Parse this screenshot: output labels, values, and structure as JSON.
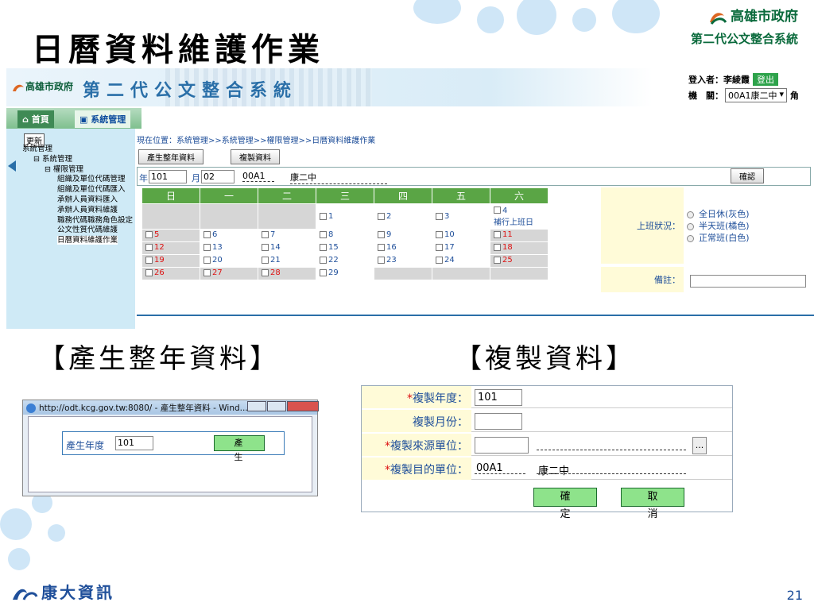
{
  "slide": {
    "title": "日曆資料維護作業",
    "gov_name": "高雄市政府",
    "gov_system": "第二代公文整合系統",
    "page_number": "21",
    "footer_company": "康大資訊"
  },
  "app": {
    "banner_logo": "高雄市政府",
    "system_title": "第二代公文整合系統",
    "login_label": "登入者：李綾霞",
    "logout_label": "登出",
    "org_label": "機　關：",
    "org_value": "00A1康二中",
    "org_trailing": "角",
    "tabs": {
      "home": "首頁",
      "system": "系統管理"
    },
    "sidebar": {
      "refresh": "更新",
      "items": [
        "系統管理",
        "系統管理",
        "權限管理",
        "組織及單位代碼管理",
        "組織及單位代碼匯入",
        "承辦人員資料匯入",
        "承辦人員資料維護",
        "職務代碼職務角色設定",
        "公文性質代碼維護",
        "日曆資料維護作業"
      ]
    },
    "breadcrumb": "現在位置：系統管理>>系統管理>>權限管理>>日曆資料維護作業",
    "buttons": {
      "generate": "產生整年資料",
      "copy": "複製資料",
      "confirm": "確認"
    },
    "filter": {
      "year_label": "年",
      "year": "101",
      "month_label": "月",
      "month": "02",
      "unit_code": "00A1",
      "unit_name": "康二中"
    },
    "calendar": {
      "weekdays": [
        "日",
        "一",
        "二",
        "三",
        "四",
        "五",
        "六"
      ],
      "extra_note": "補行上班日",
      "days": [
        {
          "d": "",
          "c": "g"
        },
        {
          "d": "",
          "c": "g"
        },
        {
          "d": "",
          "c": "g"
        },
        {
          "d": "1",
          "c": "w"
        },
        {
          "d": "2",
          "c": "w"
        },
        {
          "d": "3",
          "c": "w"
        },
        {
          "d": "4",
          "c": "w",
          "note": true
        },
        {
          "d": "5",
          "c": "g",
          "r": true
        },
        {
          "d": "6",
          "c": "w"
        },
        {
          "d": "7",
          "c": "w"
        },
        {
          "d": "8",
          "c": "w"
        },
        {
          "d": "9",
          "c": "w"
        },
        {
          "d": "10",
          "c": "w"
        },
        {
          "d": "11",
          "c": "g",
          "r": true
        },
        {
          "d": "12",
          "c": "g",
          "r": true
        },
        {
          "d": "13",
          "c": "w"
        },
        {
          "d": "14",
          "c": "w"
        },
        {
          "d": "15",
          "c": "w"
        },
        {
          "d": "16",
          "c": "w"
        },
        {
          "d": "17",
          "c": "w"
        },
        {
          "d": "18",
          "c": "g",
          "r": true
        },
        {
          "d": "19",
          "c": "g",
          "r": true
        },
        {
          "d": "20",
          "c": "w"
        },
        {
          "d": "21",
          "c": "w"
        },
        {
          "d": "22",
          "c": "w"
        },
        {
          "d": "23",
          "c": "w"
        },
        {
          "d": "24",
          "c": "w"
        },
        {
          "d": "25",
          "c": "g",
          "r": true
        },
        {
          "d": "26",
          "c": "g",
          "r": true
        },
        {
          "d": "27",
          "c": "g",
          "r": true
        },
        {
          "d": "28",
          "c": "g",
          "r": true
        },
        {
          "d": "29",
          "c": "w"
        },
        {
          "d": "",
          "c": "g"
        },
        {
          "d": "",
          "c": "g"
        },
        {
          "d": "",
          "c": "g"
        }
      ]
    },
    "work_status_label": "上班狀況：",
    "work_status_options": [
      "全日休(灰色)",
      "半天班(橘色)",
      "正常班(白色)"
    ],
    "note_label": "備註："
  },
  "section_generate": "【產生整年資料】",
  "section_copy": "【複製資料】",
  "popup": {
    "title": "http://odt.kcg.gov.tw:8080/ - 產生整年資料 - Wind...",
    "year_label": "產生年度",
    "year_value": "101",
    "generate_button": "產 生"
  },
  "copy_form": {
    "rows": [
      {
        "star": "*",
        "label": "複製年度：",
        "value": "101"
      },
      {
        "star": "",
        "label": "複製月份：",
        "value": ""
      },
      {
        "star": "*",
        "label": "複製來源單位：",
        "value": ""
      },
      {
        "star": "*",
        "label": "複製目的單位：",
        "code": "00A1",
        "name": "康二中"
      }
    ],
    "ellipsis": "...",
    "ok": "確 定",
    "cancel": "取 消"
  },
  "colors": {
    "accent_green": "#5aa545",
    "label_bg": "#fffbd8",
    "link_blue": "#1f4f9a",
    "holiday_red": "#dd1111"
  }
}
